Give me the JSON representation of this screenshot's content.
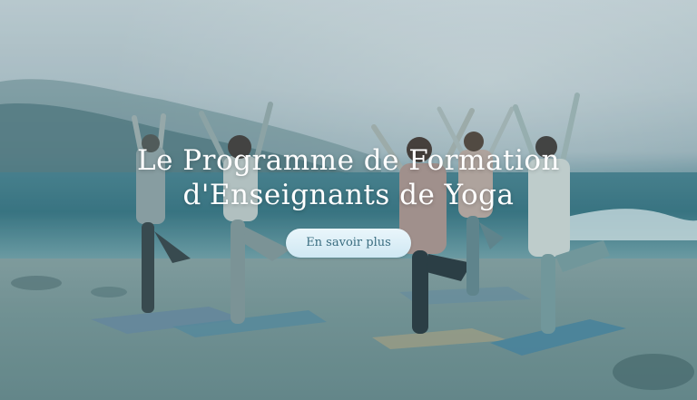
{
  "hero": {
    "title_line1": "Le Programme de Formation",
    "title_line2": "d'Enseignants de Yoga",
    "cta_label": "En savoir plus"
  },
  "colors": {
    "title_text": "#ffffff",
    "cta_background": "#d9eef7",
    "cta_text": "#3a6d80"
  }
}
